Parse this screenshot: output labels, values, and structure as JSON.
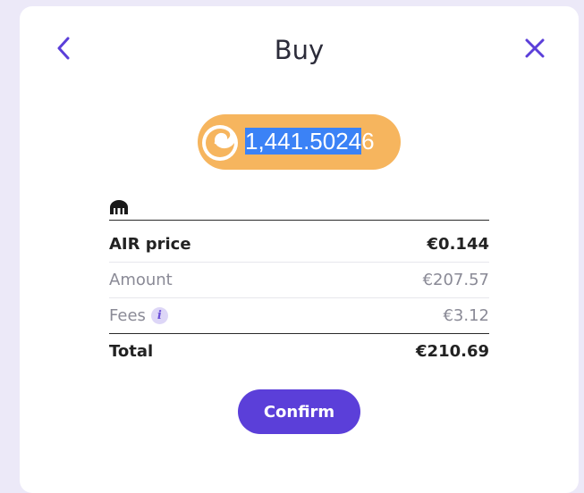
{
  "header": {
    "title": "Buy",
    "back_icon": "chevron-left-icon",
    "close_icon": "close-icon"
  },
  "amount": {
    "selected_part": "1,441.5024",
    "rest_part": "6",
    "coin_icon": "air-coin-icon",
    "pill_color": "#f6b55e"
  },
  "exchange": {
    "icon": "kraken-icon"
  },
  "breakdown": [
    {
      "label": "AIR price",
      "value": "€0.144"
    },
    {
      "label": "Amount",
      "value": "€207.57"
    },
    {
      "label": "Fees",
      "value": "€3.12"
    },
    {
      "label": "Total",
      "value": "€210.69"
    }
  ],
  "confirm_label": "Confirm",
  "colors": {
    "accent": "#5b3fd9",
    "background": "#ece9f8"
  }
}
